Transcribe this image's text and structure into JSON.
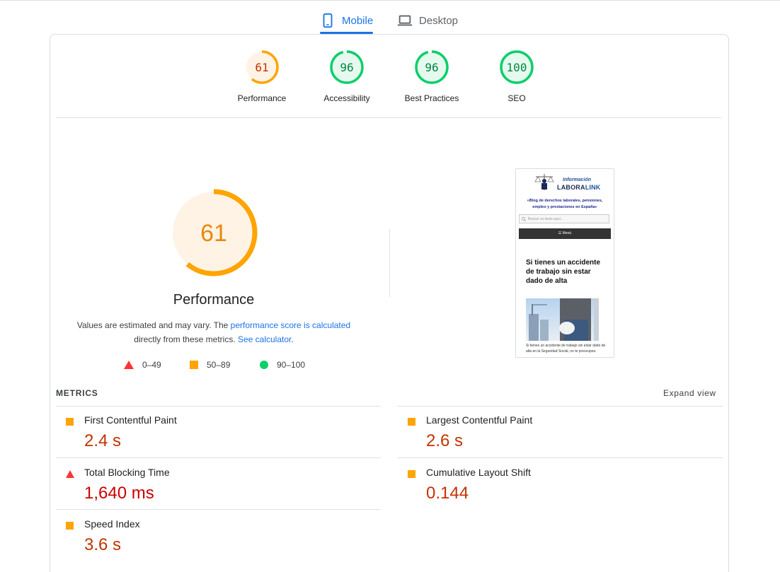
{
  "tabs": {
    "mobile_label": "Mobile",
    "desktop_label": "Desktop",
    "selected": "Mobile"
  },
  "colors": {
    "accent": "#1a73e8",
    "average": "#ffa400",
    "pass": "#0cce6b",
    "fail": "#ff3333",
    "average_text": "#c33300",
    "fail_text": "#cc0000"
  },
  "categories": [
    {
      "label": "Performance",
      "score": "61",
      "rating": "average"
    },
    {
      "label": "Accessibility",
      "score": "96",
      "rating": "pass"
    },
    {
      "label": "Best Practices",
      "score": "96",
      "rating": "pass"
    },
    {
      "label": "SEO",
      "score": "100",
      "rating": "pass"
    }
  ],
  "performance": {
    "score": "61",
    "title": "Performance",
    "desc_prefix": "Values are estimated and may vary. The ",
    "desc_link1": "performance score is calculated",
    "desc_mid": "directly from these metrics. ",
    "desc_link2": "See calculator",
    "desc_suffix": "."
  },
  "legend": [
    {
      "icon": "triangle-icon",
      "range": "0–49"
    },
    {
      "icon": "square-icon",
      "range": "50–89"
    },
    {
      "icon": "circle-icon",
      "range": "90–100"
    }
  ],
  "screenshot": {
    "brand_top": "Información",
    "brand_main_a": "LABORA",
    "brand_main_b": "LINK",
    "tagline": "«Blog de derechos laborales, pensiones, empleo y prestaciones en España»",
    "search_placeholder": "Buscar su duda aquí...",
    "menu_label": "☰ Menú",
    "article_title": "Si tienes un accidente de trabajo sin estar dado de alta",
    "article_text": "Si tienes un accidente de trabajo sin estar dado de alta en la Seguridad Social, no te preocupes."
  },
  "metrics": {
    "section_label": "METRICS",
    "expand_label": "Expand view",
    "items": [
      {
        "name": "First Contentful Paint",
        "value": "2.4 s",
        "rating": "average"
      },
      {
        "name": "Largest Contentful Paint",
        "value": "2.6 s",
        "rating": "average"
      },
      {
        "name": "Total Blocking Time",
        "value": "1,640 ms",
        "rating": "fail"
      },
      {
        "name": "Cumulative Layout Shift",
        "value": "0.144",
        "rating": "average"
      },
      {
        "name": "Speed Index",
        "value": "3.6 s",
        "rating": "average"
      }
    ]
  }
}
